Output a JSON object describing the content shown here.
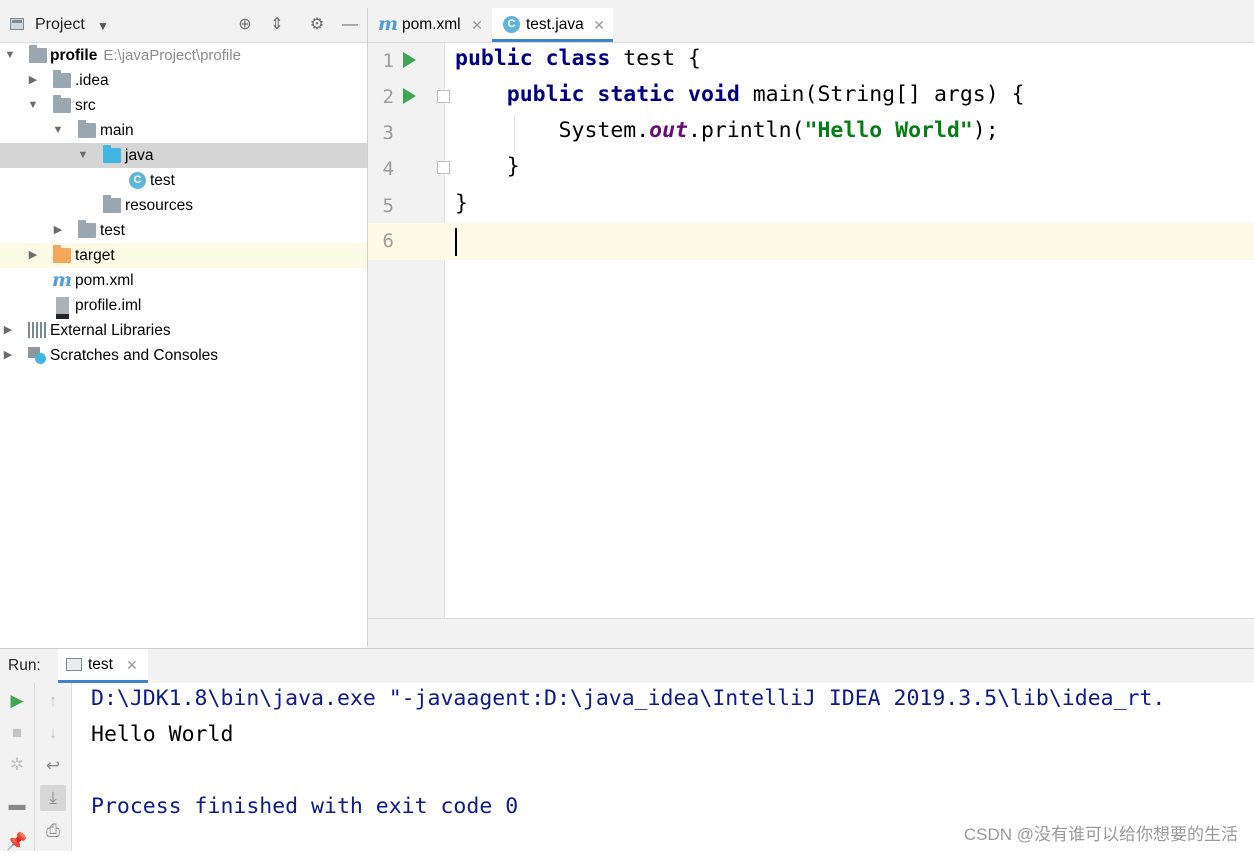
{
  "project_panel": {
    "title": "Project",
    "header_icons": [
      "locate-icon",
      "collapse-icon",
      "gear-icon",
      "minimize-icon"
    ],
    "tree": [
      {
        "label": "profile",
        "path": "E:\\javaProject\\profile",
        "icon": "module-folder-icon",
        "expanded": true
      },
      {
        "label": ".idea",
        "icon": "folder-icon",
        "expanded": false
      },
      {
        "label": "src",
        "icon": "folder-icon",
        "expanded": true
      },
      {
        "label": "main",
        "icon": "folder-icon",
        "expanded": true
      },
      {
        "label": "java",
        "icon": "source-folder-icon",
        "expanded": true,
        "selected": true
      },
      {
        "label": "test",
        "icon": "java-class-icon"
      },
      {
        "label": "resources",
        "icon": "resources-folder-icon"
      },
      {
        "label": "test",
        "icon": "folder-icon",
        "expanded": false
      },
      {
        "label": "target",
        "icon": "excluded-folder-icon",
        "expanded": false
      },
      {
        "label": "pom.xml",
        "icon": "maven-icon"
      },
      {
        "label": "profile.iml",
        "icon": "iml-file-icon"
      },
      {
        "label": "External Libraries",
        "icon": "libraries-icon",
        "expanded": false
      },
      {
        "label": "Scratches and Consoles",
        "icon": "scratches-icon",
        "expanded": false
      }
    ]
  },
  "editor": {
    "tabs": [
      {
        "label": "pom.xml",
        "icon": "maven-icon",
        "active": false
      },
      {
        "label": "test.java",
        "icon": "java-class-icon",
        "active": true
      }
    ],
    "line_numbers": [
      "1",
      "2",
      "3",
      "4",
      "5",
      "6"
    ],
    "code": {
      "l1_kw": "public class",
      "l1_rest": " test {",
      "l2_indent": "    ",
      "l2_kw": "public static void",
      "l2_rest": " main(String[] args) {",
      "l3_a": "        System.",
      "l3_field": "out",
      "l3_b": ".println(",
      "l3_str": "\"Hello World\"",
      "l3_c": ");",
      "l4": "    }",
      "l5": "}"
    },
    "current_line": "6"
  },
  "run_panel": {
    "label": "Run:",
    "tab": "test",
    "console": [
      "D:\\JDK1.8\\bin\\java.exe \"-javaagent:D:\\java_idea\\IntelliJ IDEA 2019.3.5\\lib\\idea_rt.",
      "Hello World",
      "",
      "Process finished with exit code 0"
    ]
  },
  "watermark": "CSDN @没有谁可以给你想要的生活",
  "colors": {
    "keyword": "#000080",
    "string": "#067d17",
    "field": "#660e7a",
    "run_green": "#3fa653",
    "selection": "#d5d5d5",
    "current_line": "#fdfbe6",
    "active_tab_underline": "#4083c9"
  }
}
